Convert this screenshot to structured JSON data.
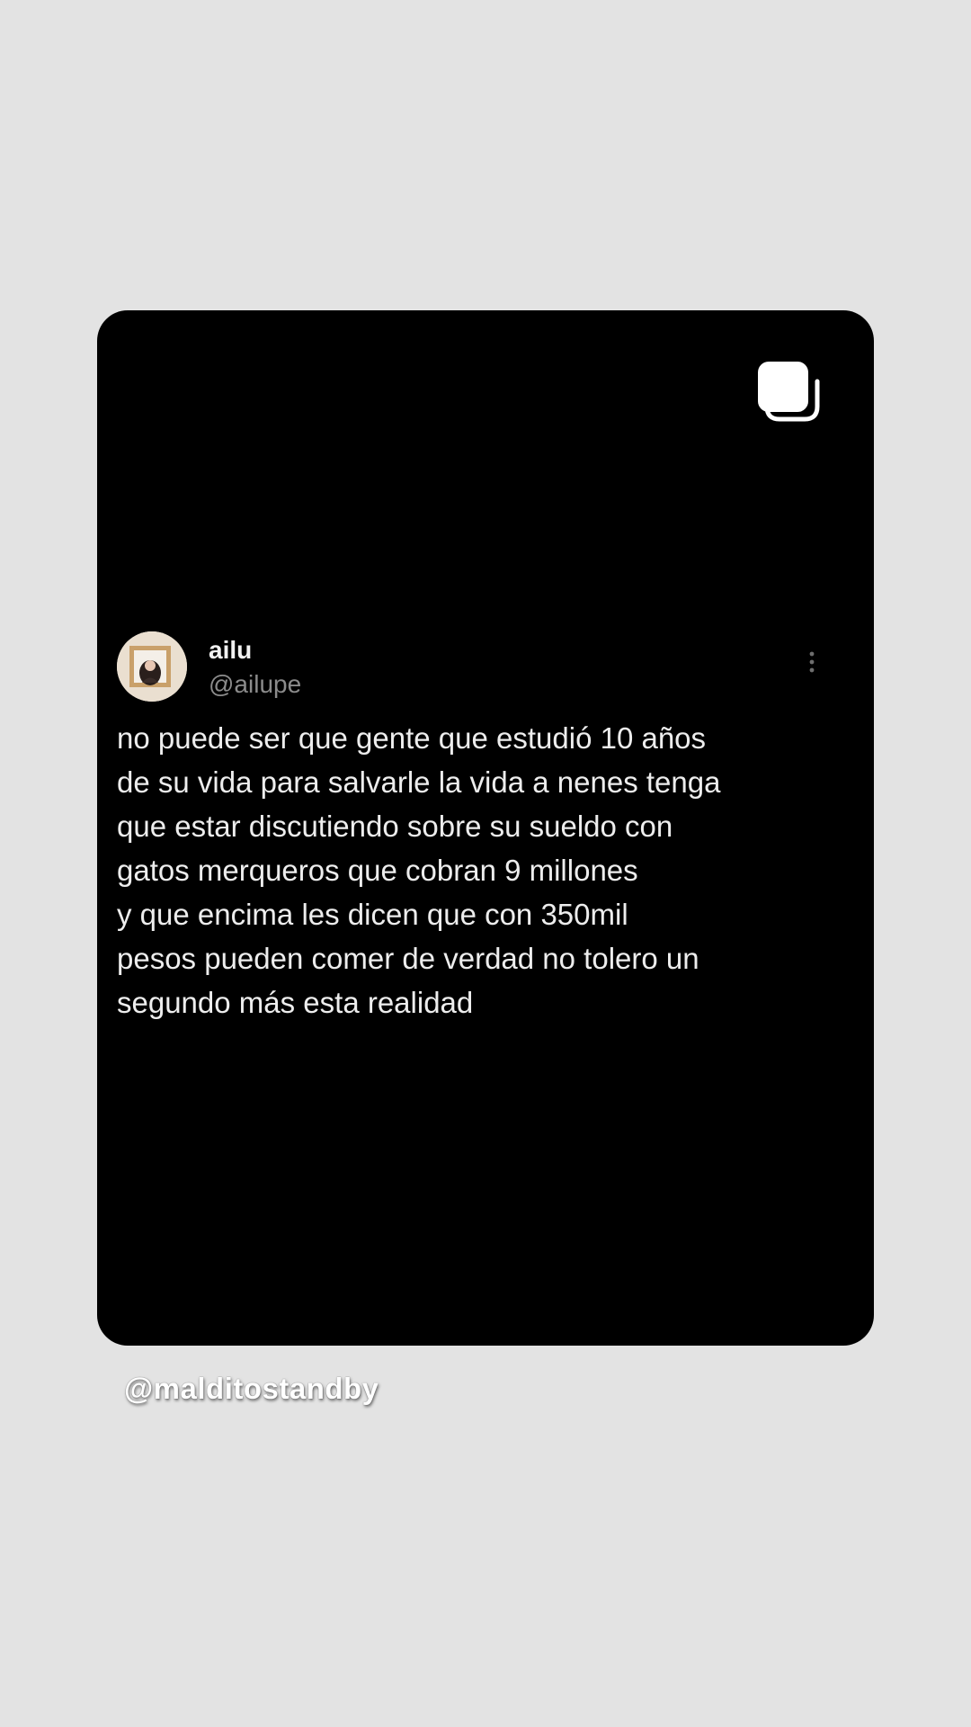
{
  "post": {
    "multiple_media_icon": "multiple-pages-icon",
    "author": {
      "display_name": "ailu",
      "handle": "@ailupe",
      "avatar": "profile-photo"
    },
    "more_icon": "vertical-ellipsis-icon",
    "text": "no puede ser que gente que estudió 10 años\nde su vida para salvarle la vida a nenes tenga\nque estar discutiendo sobre su sueldo con\ngatos merqueros que cobran 9 millones\ny que encima les dicen que con 350mil\npesos pueden comer de verdad no tolero un\nsegundo más esta realidad"
  },
  "watermark": "@malditostandby",
  "colors": {
    "background": "#e3e3e3",
    "card": "#000000",
    "text": "#ededed",
    "handle": "#8b8b8b"
  }
}
